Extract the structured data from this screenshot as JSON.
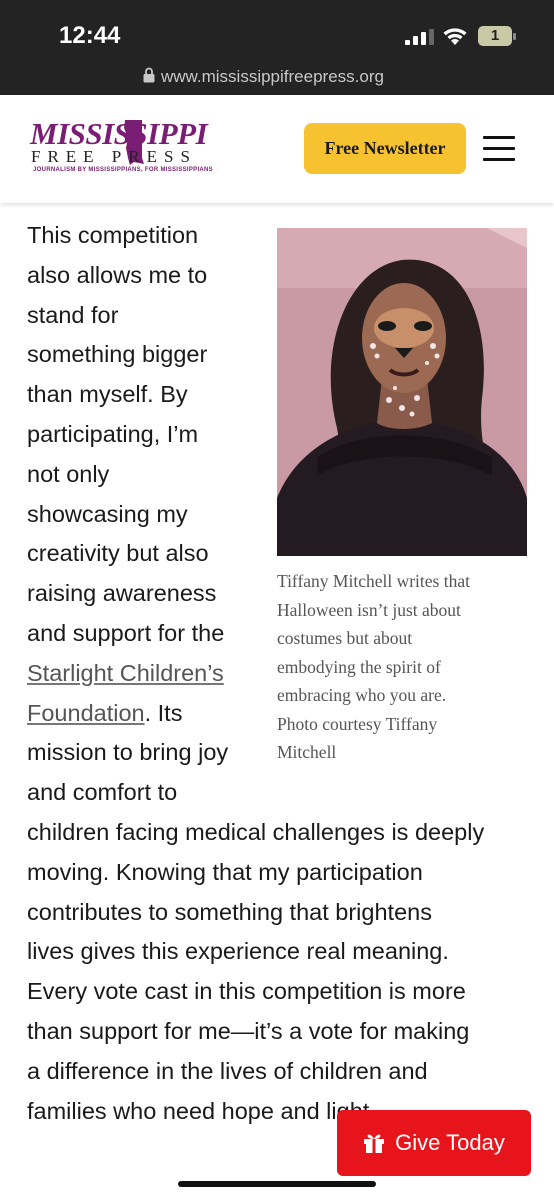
{
  "status_bar": {
    "time": "12:44",
    "battery_level": "1",
    "signal_bars": 3,
    "signal_max": 4
  },
  "browser": {
    "url": "www.mississippifreepress.org"
  },
  "header": {
    "logo_main": "MISSISSIPPI",
    "logo_sub": "FREE PRESS",
    "logo_tagline": "JOURNALISM BY MISSISSIPPIANS, FOR MISSISSIPPIANS",
    "newsletter_label": "Free Newsletter",
    "menu_icon": "hamburger-icon"
  },
  "colors": {
    "brand_purple": "#7a1e75",
    "newsletter_yellow": "#f7c230",
    "give_red": "#e8141c"
  },
  "article": {
    "lines": [
      "This competition",
      "also allows me to",
      "stand for",
      "something bigger",
      "than myself. By",
      "participating, I’m",
      "not only",
      "showcasing my",
      "creativity but also",
      "raising awareness",
      "and support for the"
    ],
    "link_line_1": "Starlight Children’s",
    "link_line_2": "Foundation",
    "after_link": ". Its",
    "lines_after": [
      "mission to bring joy",
      "and comfort to",
      "children facing medical challenges is deeply",
      "moving. Knowing that my participation",
      "contributes to something that brightens",
      "lives gives this experience real meaning.",
      "Every vote cast in this competition is more",
      "than support for me—it’s a vote for making",
      "a difference in the lives of children and",
      "families who need hope and light."
    ]
  },
  "photo": {
    "caption_lines": [
      "Tiffany Mitchell writes that",
      "Halloween isn’t just about",
      "costumes but about",
      "embodying the spirit of",
      "embracing who you are.",
      "Photo courtesy Tiffany",
      "Mitchell"
    ]
  },
  "give_button": {
    "label": "Give Today",
    "icon": "gift-icon"
  }
}
